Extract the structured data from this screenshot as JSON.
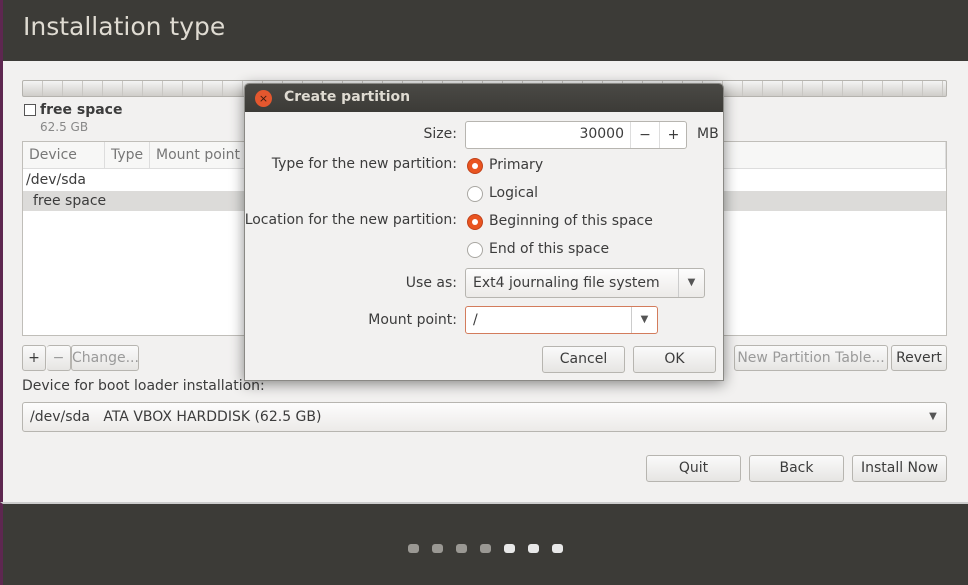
{
  "header": {
    "title": "Installation type"
  },
  "partition_bar": {
    "label": "free space",
    "size": "62.5 GB"
  },
  "table": {
    "columns": [
      "Device",
      "Type",
      "Mount point"
    ],
    "rows": [
      {
        "device": "/dev/sda"
      },
      {
        "device": "free space",
        "selected": true
      }
    ]
  },
  "table_buttons": {
    "add": "+",
    "remove": "−",
    "change": "Change...",
    "new_table": "New Partition Table...",
    "revert": "Revert"
  },
  "boot_loader": {
    "label": "Device for boot loader installation:",
    "device": "/dev/sda",
    "description": "ATA VBOX HARDDISK (62.5 GB)"
  },
  "nav": {
    "quit": "Quit",
    "back": "Back",
    "install": "Install Now"
  },
  "progress": {
    "total_steps": 7,
    "current_step": 5
  },
  "dialog": {
    "title": "Create partition",
    "size_label": "Size:",
    "size_value": "30000",
    "size_unit": "MB",
    "minus": "−",
    "plus": "+",
    "type_label": "Type for the new partition:",
    "type_options": [
      "Primary",
      "Logical"
    ],
    "type_selected": "Primary",
    "location_label": "Location for the new partition:",
    "location_options": [
      "Beginning of this space",
      "End of this space"
    ],
    "location_selected": "Beginning of this space",
    "use_as_label": "Use as:",
    "use_as_value": "Ext4 journaling file system",
    "mount_label": "Mount point:",
    "mount_value": "/",
    "cancel": "Cancel",
    "ok": "OK"
  },
  "colors": {
    "accent": "#e95420",
    "header_bg": "#3c3b37",
    "body_bg": "#f2f1f0"
  }
}
